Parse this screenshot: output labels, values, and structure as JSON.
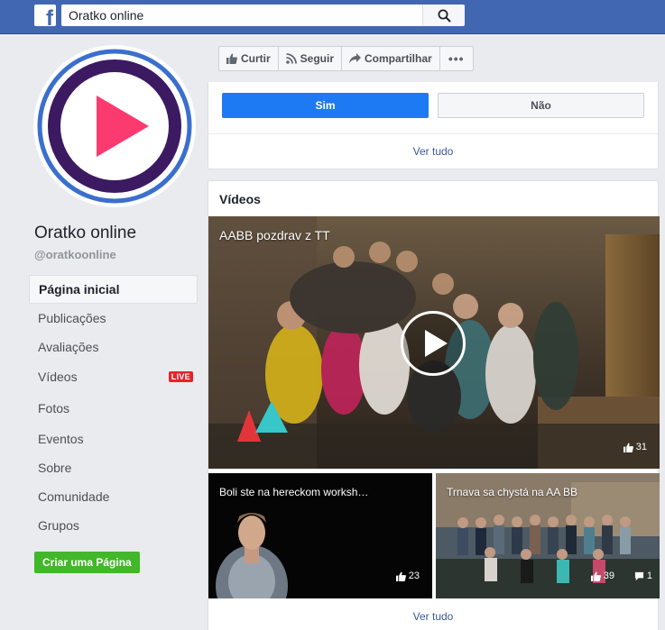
{
  "topbar": {
    "logo": "f",
    "search_value": "Oratko online",
    "search_icon": "search-icon"
  },
  "page": {
    "name": "Oratko online",
    "handle": "@oratkoonline",
    "avatar_colors": {
      "ring": "#3b6fce",
      "circle": "#3c1a61",
      "play": "#fb3b6f"
    }
  },
  "nav": {
    "items": [
      {
        "label": "Página inicial",
        "active": true
      },
      {
        "label": "Publicações"
      },
      {
        "label": "Avaliações"
      },
      {
        "label": "Vídeos",
        "badge": "LIVE"
      },
      {
        "label": "Fotos"
      },
      {
        "label": "Eventos"
      },
      {
        "label": "Sobre"
      },
      {
        "label": "Comunidade"
      },
      {
        "label": "Grupos"
      }
    ],
    "create_page_label": "Criar uma Página"
  },
  "actions": {
    "like": "Curtir",
    "follow": "Seguir",
    "share": "Compartilhar",
    "more": "•••"
  },
  "poll_card": {
    "yes": "Sim",
    "no": "Não",
    "see_all": "Ver tudo"
  },
  "videos_card": {
    "title": "Vídeos",
    "see_all": "Ver tudo",
    "main_video": {
      "title": "AABB pozdrav z TT",
      "likes": "31"
    },
    "video_left": {
      "title": "Boli ste na hereckom worksh…",
      "likes": "23"
    },
    "video_right": {
      "title": "Trnava sa chystá na AA BB",
      "likes": "39",
      "comments": "1"
    }
  },
  "colors": {
    "brand_blue": "#4267b2",
    "primary_button": "#1d7af3",
    "create_button": "#42b72a",
    "live_badge": "#e6232b"
  }
}
